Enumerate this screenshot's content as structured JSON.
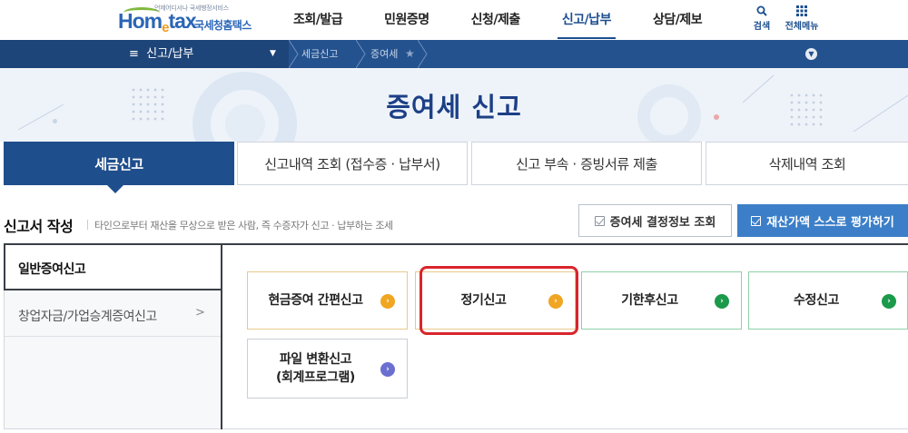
{
  "header": {
    "logo_small": "언제어디서나 국세행정서비스",
    "logo_main_1": "Hom",
    "logo_main_e": "e",
    "logo_main_2": "tax",
    "logo_kr": "국세청홈택스",
    "nav": [
      "조회/발급",
      "민원증명",
      "신청/제출",
      "신고/납부",
      "상담/제보"
    ],
    "active_nav_index": 3,
    "search_label": "검색",
    "allmenu_label": "전체메뉴"
  },
  "breadcrumb": {
    "menu": "신고/납부",
    "items": [
      "세금신고",
      "증여세"
    ]
  },
  "hero": {
    "title": "증여세 신고"
  },
  "tabs": [
    "세금신고",
    "신고내역 조회 (접수증 · 납부서)",
    "신고 부속 · 증빙서류 제출",
    "삭제내역 조회"
  ],
  "section": {
    "title": "신고서 작성",
    "desc": "타인으로부터 재산을 무상으로 받은 사람, 즉 수증자가 신고 · 납부하는 조세",
    "btn_decision": "증여세 결정정보 조회",
    "btn_evaluate": "재산가액 스스로 평가하기"
  },
  "side_menu": [
    "일반증여신고",
    "창업자금/가업승계증여신고"
  ],
  "cards": [
    {
      "label": "현금증여 간편신고",
      "icon_color": "#f0a623"
    },
    {
      "label": "정기신고",
      "icon_color": "#f0a623"
    },
    {
      "label": "기한후신고",
      "icon_color": "#1a9a4a"
    },
    {
      "label": "수정신고",
      "icon_color": "#1a9a4a"
    },
    {
      "label_line1": "파일 변환신고",
      "label_line2": "(회계프로그램)",
      "icon_color": "#6b6fcf"
    }
  ],
  "colors": {
    "primary": "#1f4e8c",
    "highlight": "#d9252b"
  }
}
